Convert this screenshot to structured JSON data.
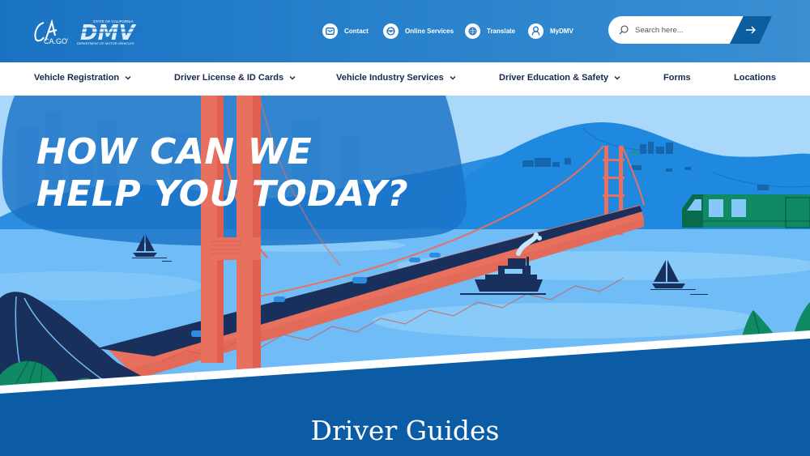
{
  "header": {
    "logos": {
      "ca_gov": "CA.GOV",
      "dmv": "DMV",
      "dmv_top": "STATE OF CALIFORNIA",
      "dmv_bottom": "DEPARTMENT OF MOTOR VEHICLES"
    },
    "utility_links": [
      {
        "label": "Contact",
        "icon": "envelope-icon"
      },
      {
        "label": "Online Services",
        "icon": "steering-wheel-icon"
      },
      {
        "label": "Translate",
        "icon": "globe-icon"
      },
      {
        "label": "MyDMV",
        "icon": "user-icon"
      }
    ],
    "search": {
      "placeholder": "Search here...",
      "submit_icon": "arrow-right-icon"
    }
  },
  "nav": {
    "items": [
      {
        "label": "Vehicle Registration",
        "dropdown": true
      },
      {
        "label": "Driver License & ID Cards",
        "dropdown": true
      },
      {
        "label": "Vehicle Industry Services",
        "dropdown": true
      },
      {
        "label": "Driver Education & Safety",
        "dropdown": true
      },
      {
        "label": "Forms",
        "dropdown": false
      },
      {
        "label": "Locations",
        "dropdown": false
      }
    ]
  },
  "hero": {
    "title_line1": "HOW CAN WE",
    "title_line2": "HELP YOU TODAY?"
  },
  "section": {
    "title": "Driver Guides"
  },
  "colors": {
    "header_blue": "#1a73c2",
    "nav_text": "#14294d",
    "bridge": "#e8705e",
    "section_blue": "#0b5ca5"
  }
}
